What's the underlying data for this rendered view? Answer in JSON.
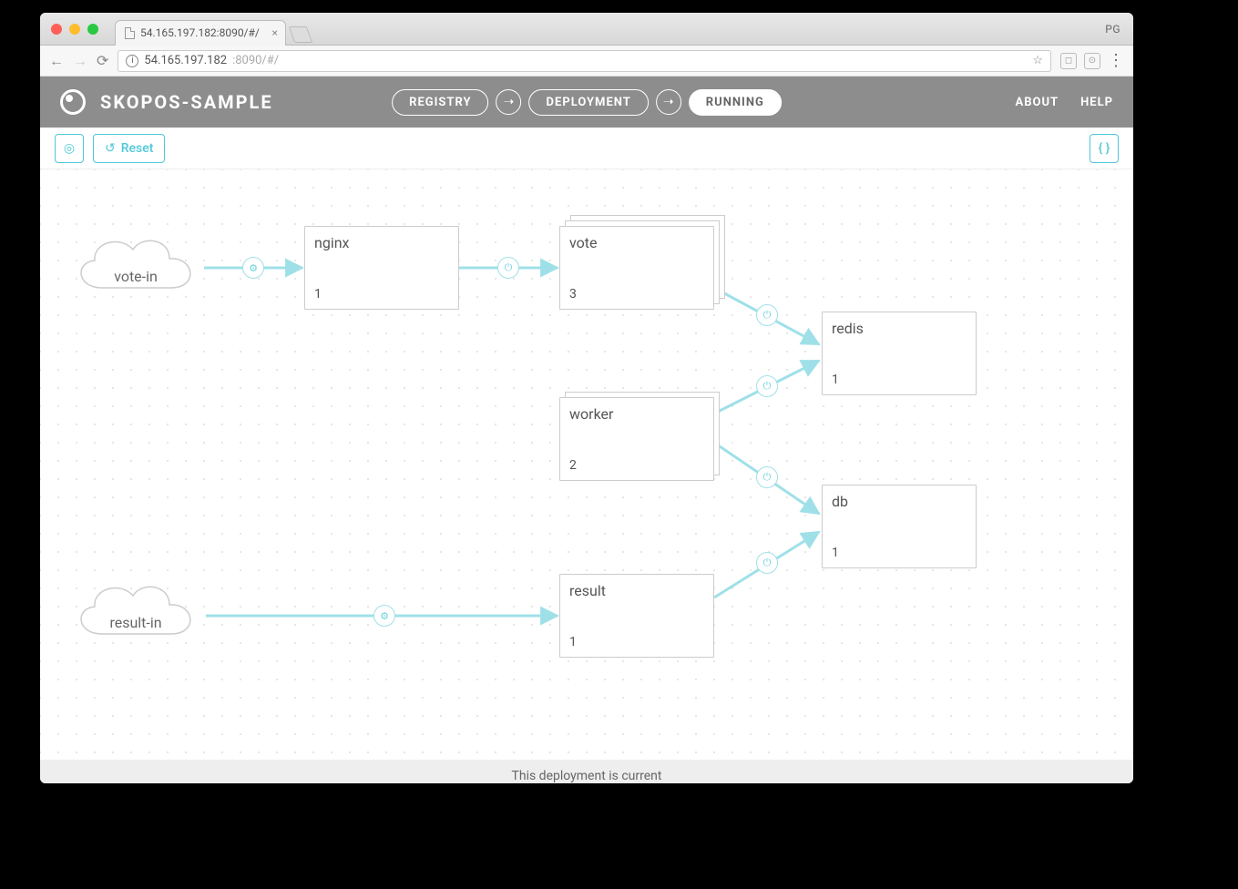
{
  "browser": {
    "tab_title": "54.165.197.182:8090/#/",
    "profile_badge": "PG",
    "url_host": "54.165.197.182",
    "url_port_path": ":8090/#/"
  },
  "header": {
    "app_title": "SKOPOS-SAMPLE",
    "nav": {
      "registry": "REGISTRY",
      "deployment": "DEPLOYMENT",
      "running": "RUNNING"
    },
    "right": {
      "about": "ABOUT",
      "help": "HELP"
    }
  },
  "toolbar": {
    "reset": "Reset"
  },
  "status": {
    "message": "This deployment is current"
  },
  "gateways": {
    "vote_in": "vote-in",
    "result_in": "result-in"
  },
  "nodes": {
    "nginx": {
      "name": "nginx",
      "replicas": "1"
    },
    "vote": {
      "name": "vote",
      "replicas": "3"
    },
    "worker": {
      "name": "worker",
      "replicas": "2"
    },
    "result": {
      "name": "result",
      "replicas": "1"
    },
    "redis": {
      "name": "redis",
      "replicas": "1"
    },
    "db": {
      "name": "db",
      "replicas": "1"
    }
  }
}
